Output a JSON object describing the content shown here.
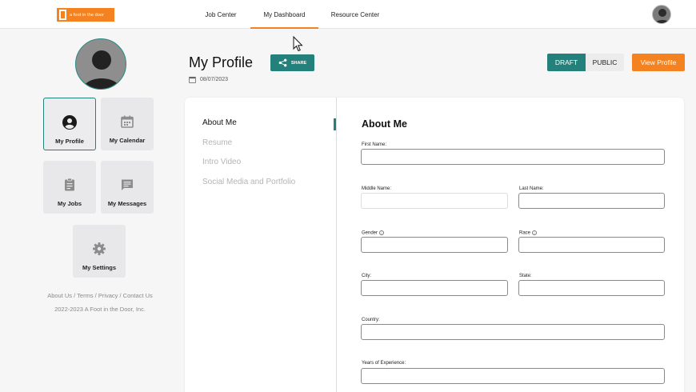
{
  "header": {
    "logo_text": "a foot in the door",
    "nav": [
      {
        "label": "Job Center"
      },
      {
        "label": "My Dashboard"
      },
      {
        "label": "Resource Center"
      }
    ]
  },
  "sidebar": {
    "tiles": [
      {
        "label": "My Profile",
        "icon": "account-circle-icon",
        "active": true
      },
      {
        "label": "My Calendar",
        "icon": "calendar-icon"
      },
      {
        "label": "My Jobs",
        "icon": "clipboard-icon"
      },
      {
        "label": "My Messages",
        "icon": "message-icon"
      },
      {
        "label": "My Settings",
        "icon": "gear-icon"
      }
    ],
    "footer_links": "About Us / Terms / Privacy / Contact Us",
    "copyright": "2022-2023 A Foot in the Door, Inc."
  },
  "profile": {
    "title": "My Profile",
    "share_label": "SHARE",
    "date": "08/07/2023",
    "draft_label": "DRAFT",
    "public_label": "PUBLIC",
    "view_profile_label": "View Profile"
  },
  "sections": [
    {
      "label": "About Me",
      "active": true
    },
    {
      "label": "Resume"
    },
    {
      "label": "Intro Video"
    },
    {
      "label": "Social Media and Portfolio"
    }
  ],
  "form": {
    "title": "About Me",
    "fields": {
      "first_name": {
        "label": "First Name:",
        "value": ""
      },
      "middle_name": {
        "label": "Middle Name:",
        "value": ""
      },
      "last_name": {
        "label": "Last Name:",
        "value": ""
      },
      "gender": {
        "label": "Gender",
        "value": ""
      },
      "race": {
        "label": "Race",
        "value": ""
      },
      "city": {
        "label": "City:",
        "value": ""
      },
      "state": {
        "label": "State:",
        "value": ""
      },
      "country": {
        "label": "Country:",
        "value": ""
      },
      "years_experience": {
        "label": "Years of Experience:",
        "value": ""
      }
    }
  },
  "colors": {
    "accent_teal": "#23807a",
    "accent_orange": "#f58220"
  }
}
